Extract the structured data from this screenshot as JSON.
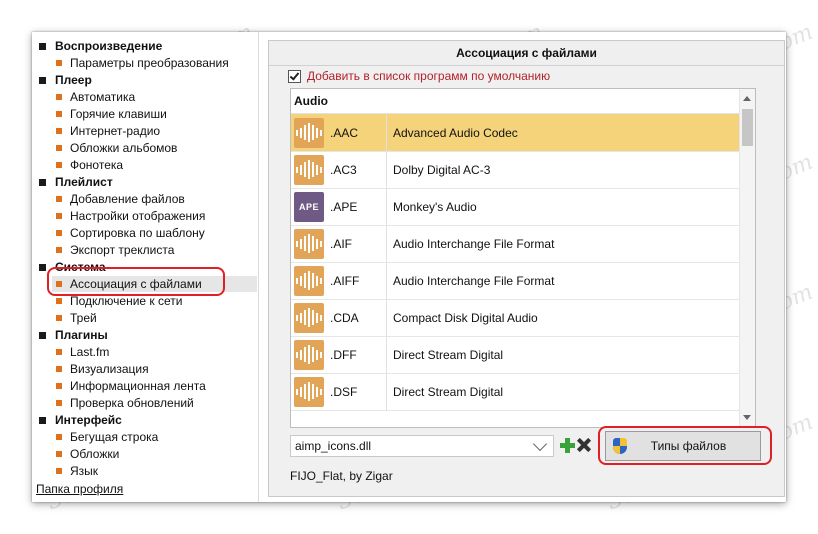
{
  "sidebar": {
    "groups": [
      {
        "title": "Воспроизведение",
        "items": [
          "Параметры преобразования"
        ]
      },
      {
        "title": "Плеер",
        "items": [
          "Автоматика",
          "Горячие клавиши",
          "Интернет-радио",
          "Обложки альбомов",
          "Фонотека"
        ]
      },
      {
        "title": "Плейлист",
        "items": [
          "Добавление файлов",
          "Настройки отображения",
          "Сортировка по шаблону",
          "Экспорт треклиста"
        ]
      },
      {
        "title": "Система",
        "items": [
          "Ассоциация с файлами",
          "Подключение к сети",
          "Трей"
        ]
      },
      {
        "title": "Плагины",
        "items": [
          "Last.fm",
          "Визуализация",
          "Информационная лента",
          "Проверка обновлений"
        ]
      },
      {
        "title": "Интерфейс",
        "items": [
          "Бегущая строка",
          "Обложки",
          "Язык"
        ]
      }
    ],
    "selected": "Ассоциация с файлами",
    "profile_link": "Папка профиля"
  },
  "panel": {
    "title": "Ассоциация с файлами",
    "default_programs_checkbox": {
      "label": "Добавить в список программ по умолчанию",
      "checked": true
    },
    "list_header": "Audio",
    "rows": [
      {
        "ext": ".AAC",
        "desc": "Advanced Audio Codec",
        "icon": "audio-wave-icon",
        "selected": true
      },
      {
        "ext": ".AC3",
        "desc": "Dolby Digital AC-3",
        "icon": "audio-wave-icon"
      },
      {
        "ext": ".APE",
        "desc": "Monkey's Audio",
        "icon": "ape-format-icon",
        "icon_text": "APE"
      },
      {
        "ext": ".AIF",
        "desc": "Audio Interchange File Format",
        "icon": "audio-wave-icon"
      },
      {
        "ext": ".AIFF",
        "desc": "Audio Interchange File Format",
        "icon": "audio-wave-icon"
      },
      {
        "ext": ".CDA",
        "desc": "Compact Disk Digital Audio",
        "icon": "audio-wave-icon"
      },
      {
        "ext": ".DFF",
        "desc": "Direct Stream Digital",
        "icon": "audio-wave-icon"
      },
      {
        "ext": ".DSF",
        "desc": "Direct Stream Digital",
        "icon": "audio-wave-icon"
      }
    ],
    "icon_set": "aimp_icons.dll",
    "icon_set_author": "FIJO_Flat, by Zigar",
    "file_types_button": "Типы файлов"
  },
  "colors": {
    "selection": "#f5d37a",
    "audio_icon": "#e2a456",
    "ape_icon": "#6f5a86",
    "bullet": "#e0711b",
    "highlight": "#e01f27",
    "checkbox_label": "#b3222a"
  },
  "watermark": "Soringpcrepair.com"
}
